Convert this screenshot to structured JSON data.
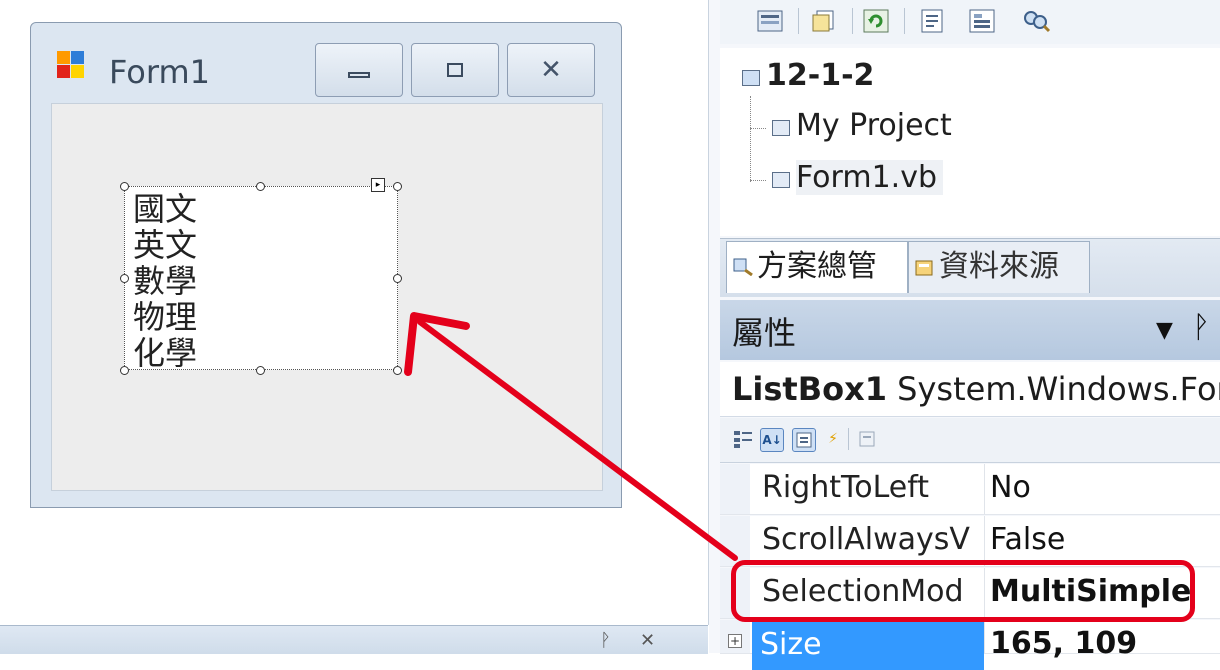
{
  "form": {
    "title": "Form1",
    "minimize_glyph": "▭",
    "maximize_glyph": "▫",
    "close_glyph": "✕",
    "listbox_items": [
      "國文",
      "英文",
      "數學",
      "物理",
      "化學"
    ]
  },
  "solution_tree": {
    "project": "12-1-2",
    "children": [
      "My Project",
      "Form1.vb"
    ]
  },
  "tabs": [
    {
      "label": "方案總管",
      "active": true
    },
    {
      "label": "資料來源",
      "active": false
    }
  ],
  "properties": {
    "header": "屬性",
    "object_name": "ListBox1",
    "object_type": "System.Windows.For",
    "rows": [
      {
        "name": "RightToLeft",
        "value": "No",
        "bold": false
      },
      {
        "name": "ScrollAlwaysV",
        "value": "False",
        "bold": false
      },
      {
        "name": "SelectionMod",
        "value": "MultiSimple",
        "bold": true
      },
      {
        "name": "Size",
        "value": "165, 109",
        "bold": true
      }
    ]
  },
  "annotation": {
    "color": "#e4001b"
  },
  "icons": [
    "toolbar-icons",
    "chevron-down-icon",
    "pin-icon",
    "close-icon",
    "expand-icon"
  ]
}
